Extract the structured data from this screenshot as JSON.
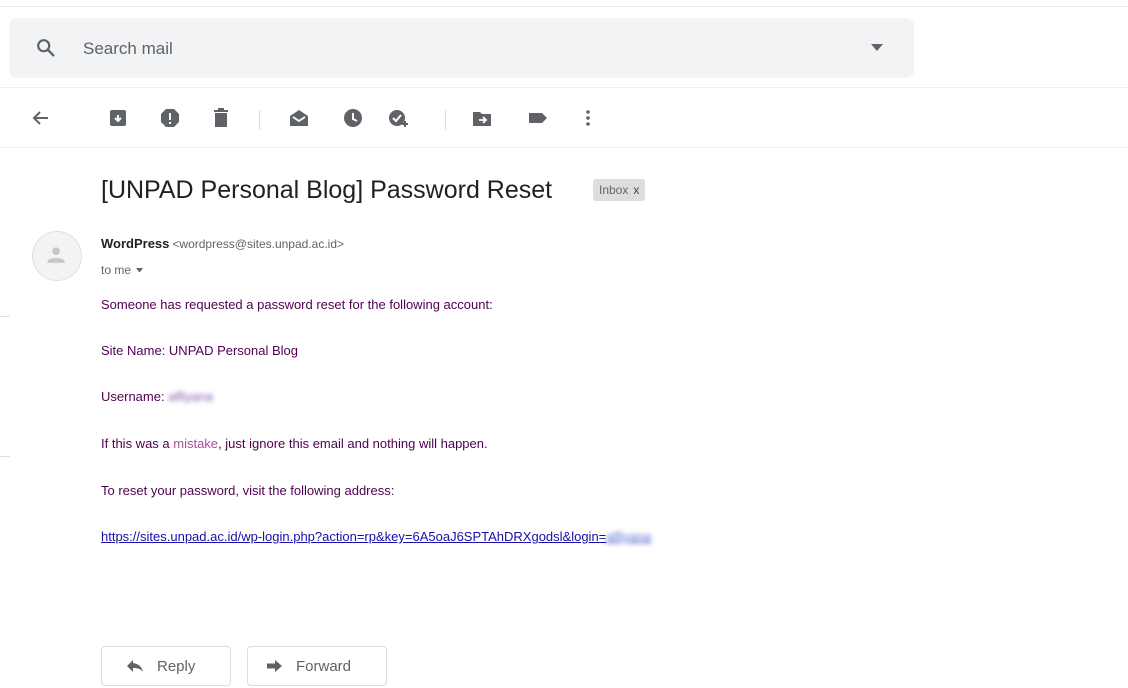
{
  "search": {
    "placeholder": "Search mail"
  },
  "toolbar": {
    "icons": [
      "back-arrow-icon",
      "archive-icon",
      "report-spam-icon",
      "delete-icon",
      "mark-unread-icon",
      "snooze-icon",
      "add-task-icon",
      "move-to-icon",
      "label-icon",
      "more-icon"
    ]
  },
  "email": {
    "subject": "[UNPAD Personal Blog] Password Reset",
    "label": "Inbox",
    "label_close": "x",
    "sender_name": "WordPress",
    "sender_address": "<wordpress@sites.unpad.ac.id>",
    "recipient": "to me",
    "lines": {
      "l1": "Someone has requested a password reset for the following account:",
      "l2": "Site Name: UNPAD Personal Blog",
      "l3_prefix": "Username:",
      "l3_value": "alfiyana",
      "l4_a": "If this was a ",
      "l4_b": "mistake",
      "l4_c": ", just ignore this email and nothing will happen.",
      "l5": "To reset your password, visit the following address:",
      "link_visible": "https://sites.unpad.ac.id/wp-login.php?action=rp&key=6A5oaJ6SPTAhDRXgodsl&login=",
      "link_blurred": "alfiyana"
    }
  },
  "actions": {
    "reply": "Reply",
    "forward": "Forward"
  },
  "colors": {
    "body_text": "#500050",
    "link": "#1a0dab",
    "search_bg": "#f1f3f4"
  }
}
